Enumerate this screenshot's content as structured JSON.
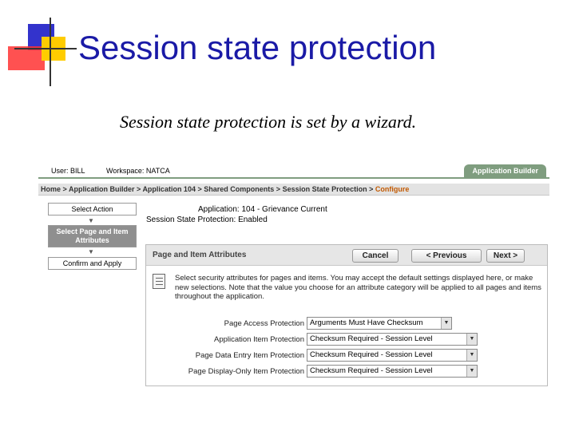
{
  "slide": {
    "title": "Session state protection",
    "subtitle": "Session state protection is set by a wizard."
  },
  "app": {
    "user": "User: BILL",
    "workspace": "Workspace: NATCA",
    "tab": "Application Builder",
    "breadcrumb": [
      "Home",
      "Application Builder",
      "Application 104",
      "Shared Components",
      "Session State Protection",
      "Configure"
    ],
    "breadcrumb_sep": ">"
  },
  "wizard": {
    "steps": [
      "Select Action",
      "Select Page and Item Attributes",
      "Confirm and Apply"
    ],
    "active_step": 1,
    "arrow": "▼"
  },
  "info": {
    "application": "Application: 104 - Grievance Current",
    "protection": "Session State Protection: Enabled"
  },
  "region": {
    "title": "Page and Item Attributes",
    "buttons": {
      "cancel": "Cancel",
      "previous": "< Previous",
      "next": "Next >"
    },
    "description": "Select security attributes for pages and items. You may accept the default settings displayed here, or make new selections. Note that the value you choose for an attribute category will be applied to all pages and items throughout the application.",
    "fields": [
      {
        "label": "Page Access Protection",
        "value": "Arguments Must Have Checksum"
      },
      {
        "label": "Application Item Protection",
        "value": "Checksum Required - Session Level"
      },
      {
        "label": "Page Data Entry Item Protection",
        "value": "Checksum Required - Session Level"
      },
      {
        "label": "Page Display-Only Item Protection",
        "value": "Checksum Required - Session Level"
      }
    ]
  },
  "colors": {
    "title_blue": "#1a1aa6",
    "tab_green": "#7f9d7f",
    "breadcrumb_active": "#c25900",
    "active_step_gray": "#8f8f8f"
  }
}
